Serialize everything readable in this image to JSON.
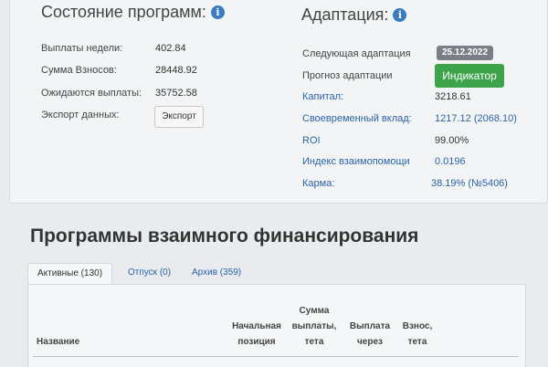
{
  "status": {
    "title": "Состояние программ:",
    "rows": [
      {
        "label": "Выплаты недели:",
        "value": "402.84"
      },
      {
        "label": "Сумма Взносов:",
        "value": "28448.92"
      },
      {
        "label": "Ожидаются выплаты:",
        "value": "35752.58"
      },
      {
        "label": "Экспорт данных:",
        "button": "Экспорт"
      }
    ]
  },
  "adaptation": {
    "title": "Адаптация:",
    "rows": [
      {
        "label": "Следующая адаптация",
        "value": "25.12.2022"
      },
      {
        "label": "Прогноз адаптации",
        "button": "Индикатор"
      },
      {
        "label": "Капитал:",
        "value": "3218.61"
      },
      {
        "label": "Своевременный вклад:",
        "value": "1217.12 (2068.10)"
      },
      {
        "label": "ROI",
        "value": "99.00%"
      },
      {
        "label": "Индекс взаимопомощи",
        "value": "0.0196"
      },
      {
        "label": "Карма:",
        "value": "38.19% (№5406)"
      }
    ]
  },
  "programs": {
    "title": "Программы взаимного финансирования",
    "tabs": [
      "Активные (130)",
      "Отпуск (0)",
      "Архив (359)"
    ],
    "columns": [
      "Название",
      "Начальная\nпозиция",
      "Сумма\nвыплаты,\nтета",
      "Выплата\nчерез",
      "Взнос,\nтета"
    ]
  },
  "colors": {
    "accent_blue": "#2a64a8",
    "info_icon": "#3a7cc0",
    "indicator_green": "#3ea44b",
    "date_badge": "#7a7f87"
  }
}
